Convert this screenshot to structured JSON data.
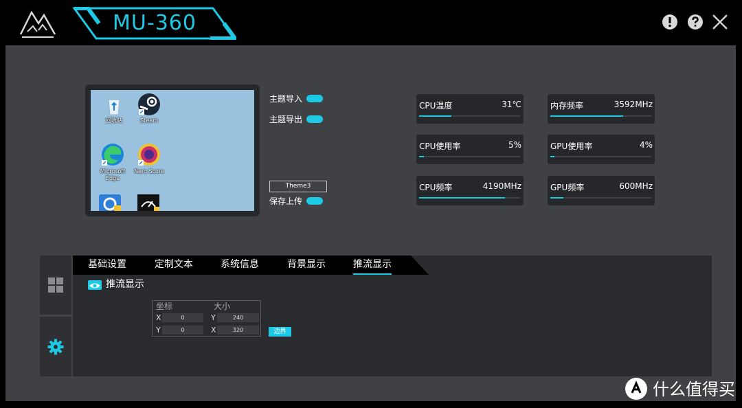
{
  "app": {
    "title": "MU-360",
    "accent": "#1ec9e6"
  },
  "preview": {
    "icons": [
      {
        "label": "回收站"
      },
      {
        "label": "Steam"
      },
      {
        "label": "Microsoft Edge"
      },
      {
        "label": "Nero Score"
      }
    ]
  },
  "theme": {
    "import_label": "主题导入",
    "export_label": "主题导出",
    "name": "Theme3",
    "save_upload_label": "保存上传"
  },
  "stats": [
    {
      "label": "CPU温度",
      "value": "31℃",
      "level": 0.32
    },
    {
      "label": "内存频率",
      "value": "3592MHz",
      "level": 0.72
    },
    {
      "label": "CPU使用率",
      "value": "5%",
      "level": 0.05
    },
    {
      "label": "GPU使用率",
      "value": "4%",
      "level": 0.04
    },
    {
      "label": "CPU频率",
      "value": "4190MHz",
      "level": 0.85
    },
    {
      "label": "GPU频率",
      "value": "600MHz",
      "level": 0.13
    }
  ],
  "tabs": [
    "基础设置",
    "定制文本",
    "系统信息",
    "背景显示",
    "推流显示"
  ],
  "active_tab": "推流显示",
  "stream": {
    "title": "推流显示",
    "coord_label": "坐标",
    "size_label": "大小",
    "x_axis": "X",
    "y_axis": "Y",
    "coord_x": "0",
    "coord_y": "0",
    "size_y": "240",
    "size_x": "320",
    "border_button": "边界"
  },
  "watermark": {
    "text": "什么值得买"
  }
}
